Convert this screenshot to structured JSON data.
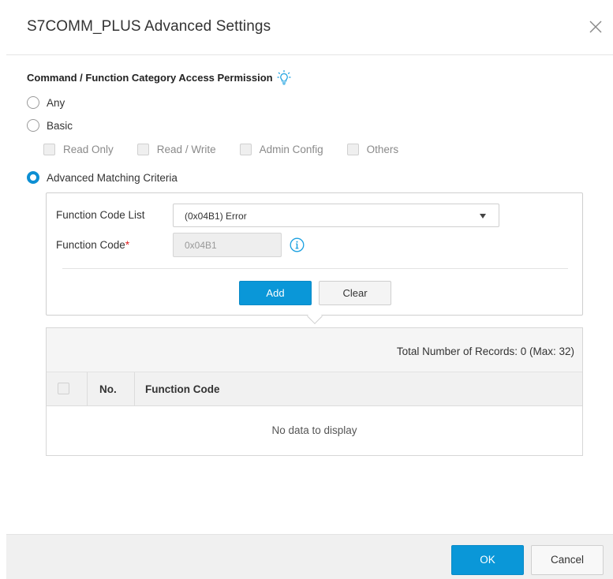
{
  "dialog": {
    "title": "S7COMM_PLUS Advanced Settings",
    "close_icon": "close-icon"
  },
  "section": {
    "title": "Command / Function Category Access Permission",
    "hint_icon": "lightbulb-icon"
  },
  "radios": {
    "any": {
      "label": "Any",
      "checked": false
    },
    "basic": {
      "label": "Basic",
      "checked": false
    },
    "advanced": {
      "label": "Advanced Matching Criteria",
      "checked": true
    }
  },
  "basic_options": [
    {
      "label": "Read Only",
      "checked": false,
      "disabled": true
    },
    {
      "label": "Read / Write",
      "checked": false,
      "disabled": true
    },
    {
      "label": "Admin Config",
      "checked": false,
      "disabled": true
    },
    {
      "label": "Others",
      "checked": false,
      "disabled": true
    }
  ],
  "advanced": {
    "function_code_list_label": "Function Code List",
    "function_code_list_value": "(0x04B1) Error",
    "function_code_label": "Function Code",
    "required_mark": "*",
    "function_code_value": "0x04B1",
    "info_icon": "info-icon",
    "add_label": "Add",
    "clear_label": "Clear"
  },
  "table": {
    "records_text": "Total Number of Records: 0 (Max: 32)",
    "columns": [
      "No.",
      "Function Code"
    ],
    "rows": [],
    "empty_text": "No data to display"
  },
  "footer": {
    "ok_label": "OK",
    "cancel_label": "Cancel"
  },
  "colors": {
    "accent": "#0a97d8",
    "required": "#e02020",
    "hint": "#1aa0e0"
  }
}
